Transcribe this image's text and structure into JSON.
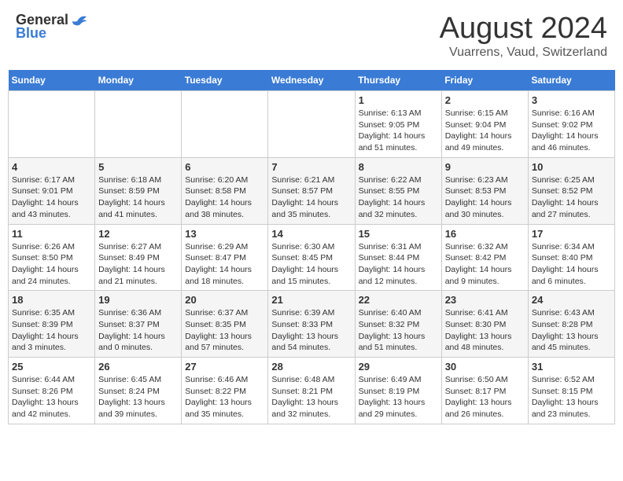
{
  "header": {
    "logo_general": "General",
    "logo_blue": "Blue",
    "month_year": "August 2024",
    "location": "Vuarrens, Vaud, Switzerland"
  },
  "days_of_week": [
    "Sunday",
    "Monday",
    "Tuesday",
    "Wednesday",
    "Thursday",
    "Friday",
    "Saturday"
  ],
  "weeks": [
    [
      {
        "day": "",
        "info": ""
      },
      {
        "day": "",
        "info": ""
      },
      {
        "day": "",
        "info": ""
      },
      {
        "day": "",
        "info": ""
      },
      {
        "day": "1",
        "info": "Sunrise: 6:13 AM\nSunset: 9:05 PM\nDaylight: 14 hours\nand 51 minutes."
      },
      {
        "day": "2",
        "info": "Sunrise: 6:15 AM\nSunset: 9:04 PM\nDaylight: 14 hours\nand 49 minutes."
      },
      {
        "day": "3",
        "info": "Sunrise: 6:16 AM\nSunset: 9:02 PM\nDaylight: 14 hours\nand 46 minutes."
      }
    ],
    [
      {
        "day": "4",
        "info": "Sunrise: 6:17 AM\nSunset: 9:01 PM\nDaylight: 14 hours\nand 43 minutes."
      },
      {
        "day": "5",
        "info": "Sunrise: 6:18 AM\nSunset: 8:59 PM\nDaylight: 14 hours\nand 41 minutes."
      },
      {
        "day": "6",
        "info": "Sunrise: 6:20 AM\nSunset: 8:58 PM\nDaylight: 14 hours\nand 38 minutes."
      },
      {
        "day": "7",
        "info": "Sunrise: 6:21 AM\nSunset: 8:57 PM\nDaylight: 14 hours\nand 35 minutes."
      },
      {
        "day": "8",
        "info": "Sunrise: 6:22 AM\nSunset: 8:55 PM\nDaylight: 14 hours\nand 32 minutes."
      },
      {
        "day": "9",
        "info": "Sunrise: 6:23 AM\nSunset: 8:53 PM\nDaylight: 14 hours\nand 30 minutes."
      },
      {
        "day": "10",
        "info": "Sunrise: 6:25 AM\nSunset: 8:52 PM\nDaylight: 14 hours\nand 27 minutes."
      }
    ],
    [
      {
        "day": "11",
        "info": "Sunrise: 6:26 AM\nSunset: 8:50 PM\nDaylight: 14 hours\nand 24 minutes."
      },
      {
        "day": "12",
        "info": "Sunrise: 6:27 AM\nSunset: 8:49 PM\nDaylight: 14 hours\nand 21 minutes."
      },
      {
        "day": "13",
        "info": "Sunrise: 6:29 AM\nSunset: 8:47 PM\nDaylight: 14 hours\nand 18 minutes."
      },
      {
        "day": "14",
        "info": "Sunrise: 6:30 AM\nSunset: 8:45 PM\nDaylight: 14 hours\nand 15 minutes."
      },
      {
        "day": "15",
        "info": "Sunrise: 6:31 AM\nSunset: 8:44 PM\nDaylight: 14 hours\nand 12 minutes."
      },
      {
        "day": "16",
        "info": "Sunrise: 6:32 AM\nSunset: 8:42 PM\nDaylight: 14 hours\nand 9 minutes."
      },
      {
        "day": "17",
        "info": "Sunrise: 6:34 AM\nSunset: 8:40 PM\nDaylight: 14 hours\nand 6 minutes."
      }
    ],
    [
      {
        "day": "18",
        "info": "Sunrise: 6:35 AM\nSunset: 8:39 PM\nDaylight: 14 hours\nand 3 minutes."
      },
      {
        "day": "19",
        "info": "Sunrise: 6:36 AM\nSunset: 8:37 PM\nDaylight: 14 hours\nand 0 minutes."
      },
      {
        "day": "20",
        "info": "Sunrise: 6:37 AM\nSunset: 8:35 PM\nDaylight: 13 hours\nand 57 minutes."
      },
      {
        "day": "21",
        "info": "Sunrise: 6:39 AM\nSunset: 8:33 PM\nDaylight: 13 hours\nand 54 minutes."
      },
      {
        "day": "22",
        "info": "Sunrise: 6:40 AM\nSunset: 8:32 PM\nDaylight: 13 hours\nand 51 minutes."
      },
      {
        "day": "23",
        "info": "Sunrise: 6:41 AM\nSunset: 8:30 PM\nDaylight: 13 hours\nand 48 minutes."
      },
      {
        "day": "24",
        "info": "Sunrise: 6:43 AM\nSunset: 8:28 PM\nDaylight: 13 hours\nand 45 minutes."
      }
    ],
    [
      {
        "day": "25",
        "info": "Sunrise: 6:44 AM\nSunset: 8:26 PM\nDaylight: 13 hours\nand 42 minutes."
      },
      {
        "day": "26",
        "info": "Sunrise: 6:45 AM\nSunset: 8:24 PM\nDaylight: 13 hours\nand 39 minutes."
      },
      {
        "day": "27",
        "info": "Sunrise: 6:46 AM\nSunset: 8:22 PM\nDaylight: 13 hours\nand 35 minutes."
      },
      {
        "day": "28",
        "info": "Sunrise: 6:48 AM\nSunset: 8:21 PM\nDaylight: 13 hours\nand 32 minutes."
      },
      {
        "day": "29",
        "info": "Sunrise: 6:49 AM\nSunset: 8:19 PM\nDaylight: 13 hours\nand 29 minutes."
      },
      {
        "day": "30",
        "info": "Sunrise: 6:50 AM\nSunset: 8:17 PM\nDaylight: 13 hours\nand 26 minutes."
      },
      {
        "day": "31",
        "info": "Sunrise: 6:52 AM\nSunset: 8:15 PM\nDaylight: 13 hours\nand 23 minutes."
      }
    ]
  ]
}
